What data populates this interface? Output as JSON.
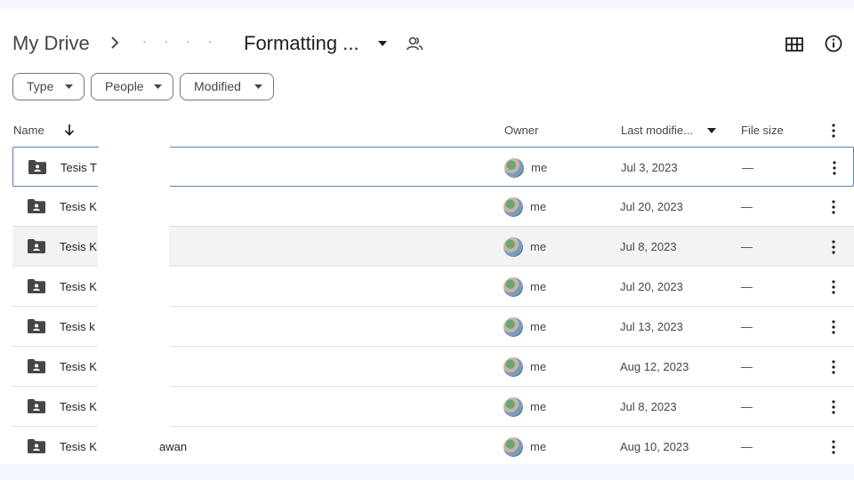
{
  "breadcrumb": {
    "root": "My Drive",
    "middle": "· · · ·",
    "current": "Formatting ..."
  },
  "filters": [
    {
      "label": "Type"
    },
    {
      "label": "People"
    },
    {
      "label": "Modified"
    }
  ],
  "columns": {
    "name": "Name",
    "owner": "Owner",
    "modified": "Last modifie...",
    "size": "File size"
  },
  "rows": [
    {
      "name": "Tesis T",
      "tail": "",
      "owner": "me",
      "modified": "Jul 3, 2023",
      "size": "—"
    },
    {
      "name": "Tesis K",
      "tail": "",
      "owner": "me",
      "modified": "Jul 20, 2023",
      "size": "—"
    },
    {
      "name": "Tesis K",
      "tail": "",
      "owner": "me",
      "modified": "Jul 8, 2023",
      "size": "—"
    },
    {
      "name": "Tesis K",
      "tail": "",
      "owner": "me",
      "modified": "Jul 20, 2023",
      "size": "—"
    },
    {
      "name": "Tesis k",
      "tail": "",
      "owner": "me",
      "modified": "Jul 13, 2023",
      "size": "—"
    },
    {
      "name": "Tesis K",
      "tail": "",
      "owner": "me",
      "modified": "Aug 12, 2023",
      "size": "—"
    },
    {
      "name": "Tesis K",
      "tail": "",
      "owner": "me",
      "modified": "Jul 8, 2023",
      "size": "—"
    },
    {
      "name": "Tesis K",
      "tail": "awan",
      "owner": "me",
      "modified": "Aug 10, 2023",
      "size": "—"
    }
  ],
  "icons": {
    "breadcrumb_separator": "chevron-right-icon",
    "folder_menu": "caret-down-icon",
    "shared": "people-icon",
    "view_toggle": "grid-view-icon",
    "details": "info-icon",
    "sort": "arrow-down-icon",
    "row_folder": "shared-folder-icon",
    "row_actions": "more-vert-icon"
  },
  "colors": {
    "selected_border": "#5f80a8",
    "hover_row": "#f1f3f4",
    "chip_border": "#747775",
    "text_secondary": "#444746"
  }
}
